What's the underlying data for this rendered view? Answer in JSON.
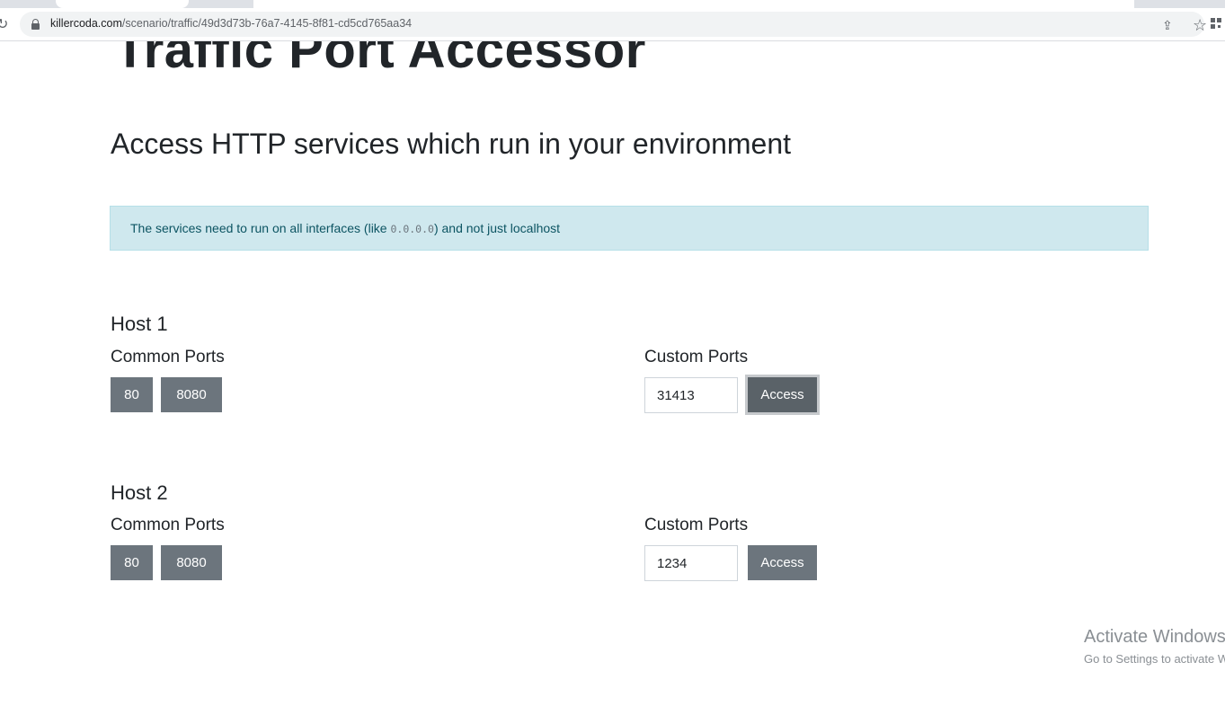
{
  "browser": {
    "url_host": "killercoda.com",
    "url_path": "/scenario/traffic/49d3d73b-76a7-4145-8f81-cd5cd765aa34"
  },
  "page": {
    "title": "Traffic Port Accessor",
    "subtitle": "Access HTTP services which run in your environment",
    "alert": {
      "text_before": "The services need to run on all interfaces (like ",
      "code": "0.0.0.0",
      "text_after": ") and not just localhost"
    }
  },
  "hosts": [
    {
      "title": "Host 1",
      "common_label": "Common Ports",
      "custom_label": "Custom Ports",
      "common_ports": [
        "80",
        "8080"
      ],
      "custom_value": "31413",
      "access_label": "Access"
    },
    {
      "title": "Host 2",
      "common_label": "Common Ports",
      "custom_label": "Custom Ports",
      "common_ports": [
        "80",
        "8080"
      ],
      "custom_value": "1234",
      "access_label": "Access"
    }
  ],
  "watermark": {
    "title": "Activate Windows",
    "subtitle": "Go to Settings to activate Windows."
  },
  "colors": {
    "button": "#6c757d",
    "alert_bg": "#cfe8ee",
    "alert_text": "#0c5462"
  },
  "icons": [
    "reload-icon",
    "lock-icon",
    "share-icon",
    "star-icon",
    "qr-code-icon"
  ]
}
